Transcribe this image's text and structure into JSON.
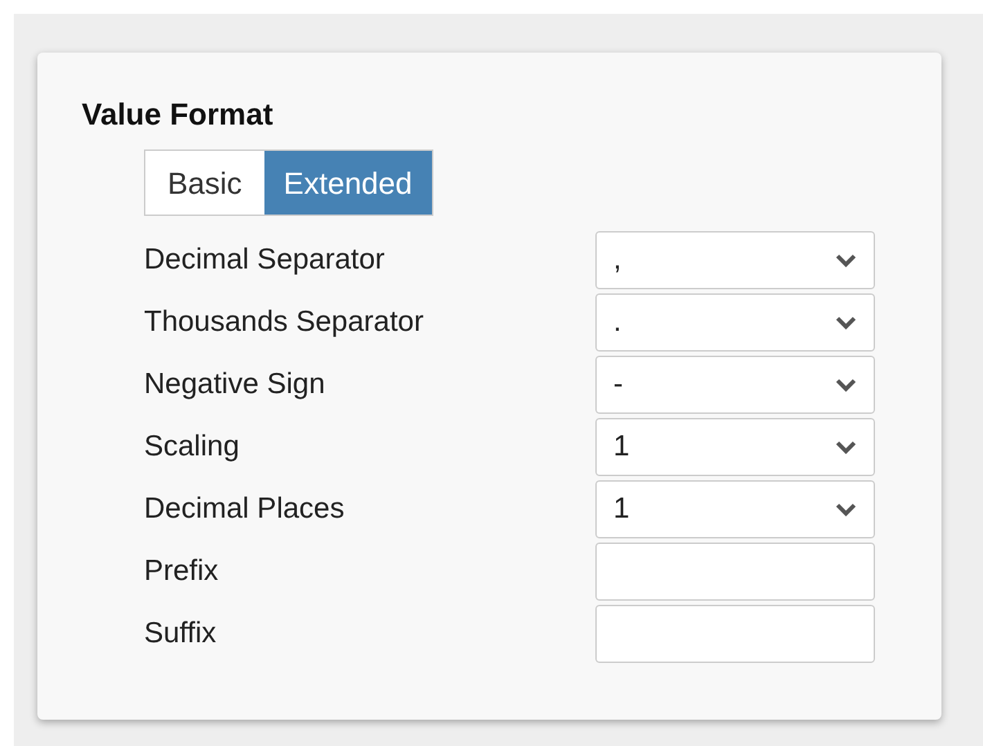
{
  "panel": {
    "title": "Value Format"
  },
  "tabs": [
    {
      "label": "Basic",
      "selected": false
    },
    {
      "label": "Extended",
      "selected": true
    }
  ],
  "fields": [
    {
      "label": "Decimal Separator",
      "kind": "select",
      "value": ","
    },
    {
      "label": "Thousands Separator",
      "kind": "select",
      "value": "."
    },
    {
      "label": "Negative Sign",
      "kind": "select",
      "value": "-"
    },
    {
      "label": "Scaling",
      "kind": "select",
      "value": "1"
    },
    {
      "label": "Decimal Places",
      "kind": "select",
      "value": "1"
    },
    {
      "label": "Prefix",
      "kind": "text"
    },
    {
      "label": "Suffix",
      "kind": "text"
    }
  ]
}
